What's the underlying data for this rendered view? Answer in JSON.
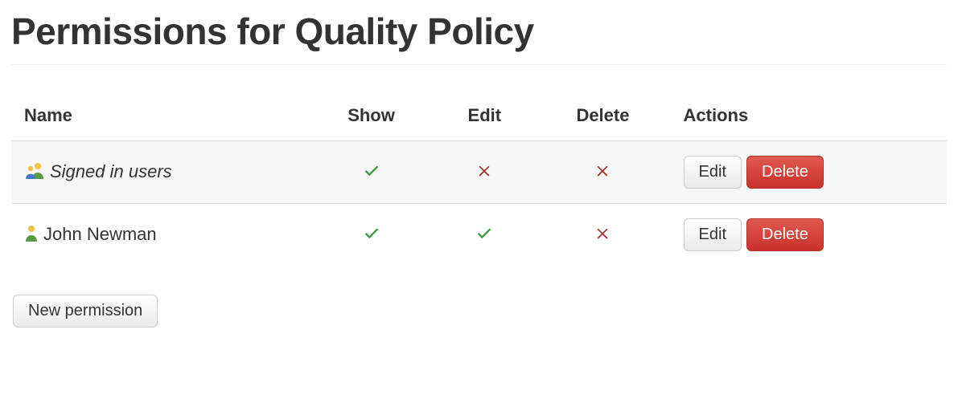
{
  "page": {
    "title": "Permissions for Quality Policy"
  },
  "table": {
    "headers": {
      "name": "Name",
      "show": "Show",
      "edit": "Edit",
      "del": "Delete",
      "actions": "Actions"
    },
    "row_action_labels": {
      "edit": "Edit",
      "del": "Delete"
    },
    "rows": [
      {
        "icon": "group",
        "name": "Signed in users",
        "italic": true,
        "show": true,
        "edit": false,
        "del": false
      },
      {
        "icon": "person",
        "name": "John Newman",
        "italic": false,
        "show": true,
        "edit": true,
        "del": false
      }
    ]
  },
  "buttons": {
    "new_permission": "New permission"
  }
}
